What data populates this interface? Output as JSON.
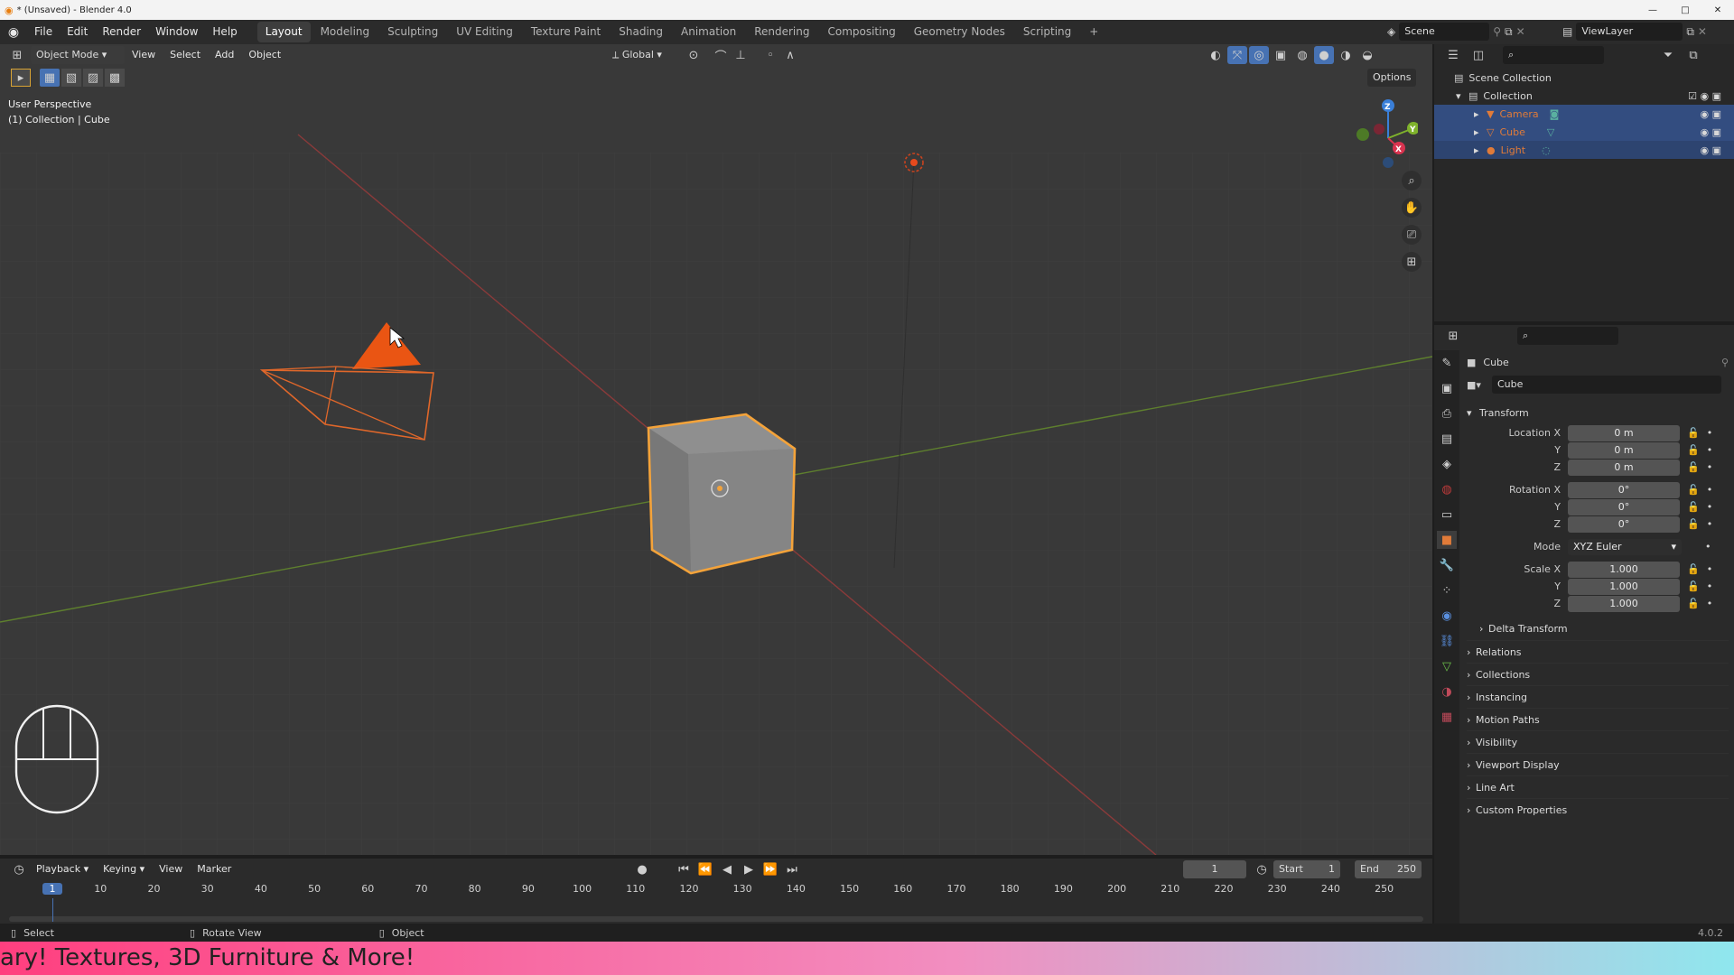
{
  "window": {
    "title": "* (Unsaved) - Blender 4.0"
  },
  "menus": [
    "File",
    "Edit",
    "Render",
    "Window",
    "Help"
  ],
  "workspaces": [
    "Layout",
    "Modeling",
    "Sculpting",
    "UV Editing",
    "Texture Paint",
    "Shading",
    "Animation",
    "Rendering",
    "Compositing",
    "Geometry Nodes",
    "Scripting"
  ],
  "workspace_add": "+",
  "scene": {
    "name": "Scene",
    "view_layer": "ViewLayer"
  },
  "viewport": {
    "mode": "Object Mode",
    "menu": [
      "View",
      "Select",
      "Add",
      "Object"
    ],
    "orientation": "Global",
    "options": "Options",
    "overlay_line1": "User Perspective",
    "overlay_line2": "(1) Collection | Cube",
    "gizmo": {
      "x": "X",
      "y": "Y",
      "z": "Z"
    }
  },
  "outliner": {
    "root": "Scene Collection",
    "collection": "Collection",
    "items": [
      {
        "name": "Camera",
        "color": "#e07b39"
      },
      {
        "name": "Cube",
        "color": "#e07b39"
      },
      {
        "name": "Light",
        "color": "#e07b39"
      }
    ]
  },
  "properties": {
    "object_name": "Cube",
    "data_name": "Cube",
    "transform": "Transform",
    "location": {
      "label": "Location X",
      "x": "0 m",
      "y": "0 m",
      "z": "0 m"
    },
    "rotation": {
      "label": "Rotation X",
      "x": "0°",
      "y": "0°",
      "z": "0°"
    },
    "mode_label": "Mode",
    "mode": "XYZ Euler",
    "scale": {
      "label": "Scale X",
      "x": "1.000",
      "y": "1.000",
      "z": "1.000"
    },
    "axis_y": "Y",
    "axis_z": "Z",
    "delta": "Delta Transform",
    "panels": [
      "Relations",
      "Collections",
      "Instancing",
      "Motion Paths",
      "Visibility",
      "Viewport Display",
      "Line Art",
      "Custom Properties"
    ]
  },
  "timeline": {
    "menus": [
      "Playback",
      "Keying",
      "View",
      "Marker"
    ],
    "current_frame": "1",
    "start_label": "Start",
    "start": "1",
    "end_label": "End",
    "end": "250",
    "ticks": [
      "1",
      "10",
      "20",
      "30",
      "40",
      "50",
      "60",
      "70",
      "80",
      "90",
      "100",
      "110",
      "120",
      "130",
      "140",
      "150",
      "160",
      "170",
      "180",
      "190",
      "200",
      "210",
      "220",
      "230",
      "240",
      "250"
    ]
  },
  "status": {
    "select": "Select",
    "rotate": "Rotate View",
    "object": "Object",
    "version": "4.0.2"
  },
  "banner": {
    "text": "ary! Textures, 3D Furniture & More!"
  }
}
